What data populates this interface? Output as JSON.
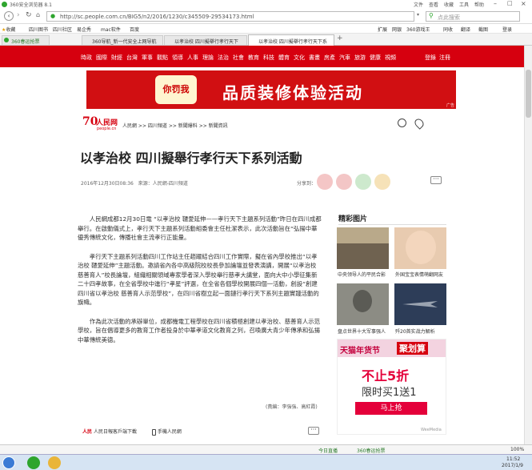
{
  "browser": {
    "title": "360安全浏览器 8.1",
    "menu": [
      "文件",
      "查看",
      "收藏",
      "工具",
      "帮助"
    ],
    "url": "http://sc.people.com.cn/BIG5/n2/2016/1230/c345509-29534173.html",
    "search_placeholder": "点此搜索",
    "favorites": [
      "收藏",
      "四川图书",
      "四川社区",
      "易企秀",
      "mac软件",
      "百度"
    ],
    "fav_extras": [
      "扩展",
      "网银",
      "360游戏王",
      "同收",
      "翻译",
      "截图",
      "登录"
    ],
    "tabs": [
      "360春运抢票",
      "360导航_新一代安全上网导航",
      "以孝治校 四川擬舉行孝行天下",
      "以孝治校 四川擬舉行孝行天下系"
    ]
  },
  "nav": {
    "items": [
      "時政",
      "國際",
      "財經",
      "台灣",
      "軍事",
      "觀點",
      "領導",
      "人事",
      "理論",
      "法治",
      "社會",
      "教育",
      "科技",
      "體育",
      "文化",
      "書畫",
      "房產",
      "汽車",
      "旅游",
      "健康",
      "視頻"
    ],
    "right": [
      "登錄",
      "注冊"
    ]
  },
  "banner": {
    "left": "你罚我",
    "text": "品质装修体验活动",
    "adtag": "广告"
  },
  "header": {
    "logo": "人民网",
    "logo_sub": "people.cn",
    "breadcrumb": [
      "人民網",
      "四川頻道",
      "新聞爆料",
      "新聞資訊"
    ]
  },
  "article": {
    "title": "以孝治校 四川擬舉行孝行天下系列活動",
    "date": "2016年12月30日08:36",
    "source": "來源：人民網-四川頻道",
    "share_label": "分享到：",
    "paragraphs": [
      "人民網成都12月30日電 “以孝治校 韆愛延伸——孝行天下主題系列活動”昨日在四川成都舉行。在啟動儀式上，孝行天下主題系列活動組委會主任杜潔表示，此次活動旨在“弘揚中華優秀傳統文化，傳播社會主流孝行正能量。",
      "孝行天下主題系列活動四川工作站主任趙躍結合四川工作實際，擬在省內學校推出“以孝治校 韆愛延伸”主題活動。邀請省內各中高級院校校長參加論壇並發表演講，開展“以孝治校 慈善育人”校長論壇，組織相關領域專家學者深入學校舉行慈孝大講堂，面向大中小學征集新二十四孝故事，在全省學校中進行“孝星”評選，在全省各個學校開展四個一活動，創設“創建四川省以孝治校 慈善育人示范學校”，在四川省樹立起一面鏈行孝行天下系列主題實踐活動的旗幟。",
      "作為此次活動的承辦單位，成都機電工程學校在四川省積極創建以孝治校、慈善育人示范學校，旨在倡導更多的教育工作者投身於中華孝道文化教育之列，召喚廣大青少年傳承和弘揚中華傳統美德。"
    ],
    "editor": "(責編：李強強、高紅霞)",
    "app1": "人民日報客戶端下載",
    "app2": "手機人民網"
  },
  "sidebar": {
    "title": "精彩图片",
    "captions": [
      "中央领导人的平民合影",
      "外国宝宝表情萌翻网友",
      "盘点世界十大军事强人",
      "歼20首实战力解析"
    ],
    "ad": {
      "brand": "天猫年货节",
      "headline": "聚划算",
      "sale": "不止5折",
      "limited": "限时买1送1",
      "button": "马上抢",
      "credit": "WeeMedia"
    }
  },
  "status": {
    "left": "",
    "items": [
      "今日直播",
      "360春运抢票",
      "100%"
    ]
  },
  "taskbar": {
    "time": "11:52",
    "date": "2017/1/9"
  }
}
